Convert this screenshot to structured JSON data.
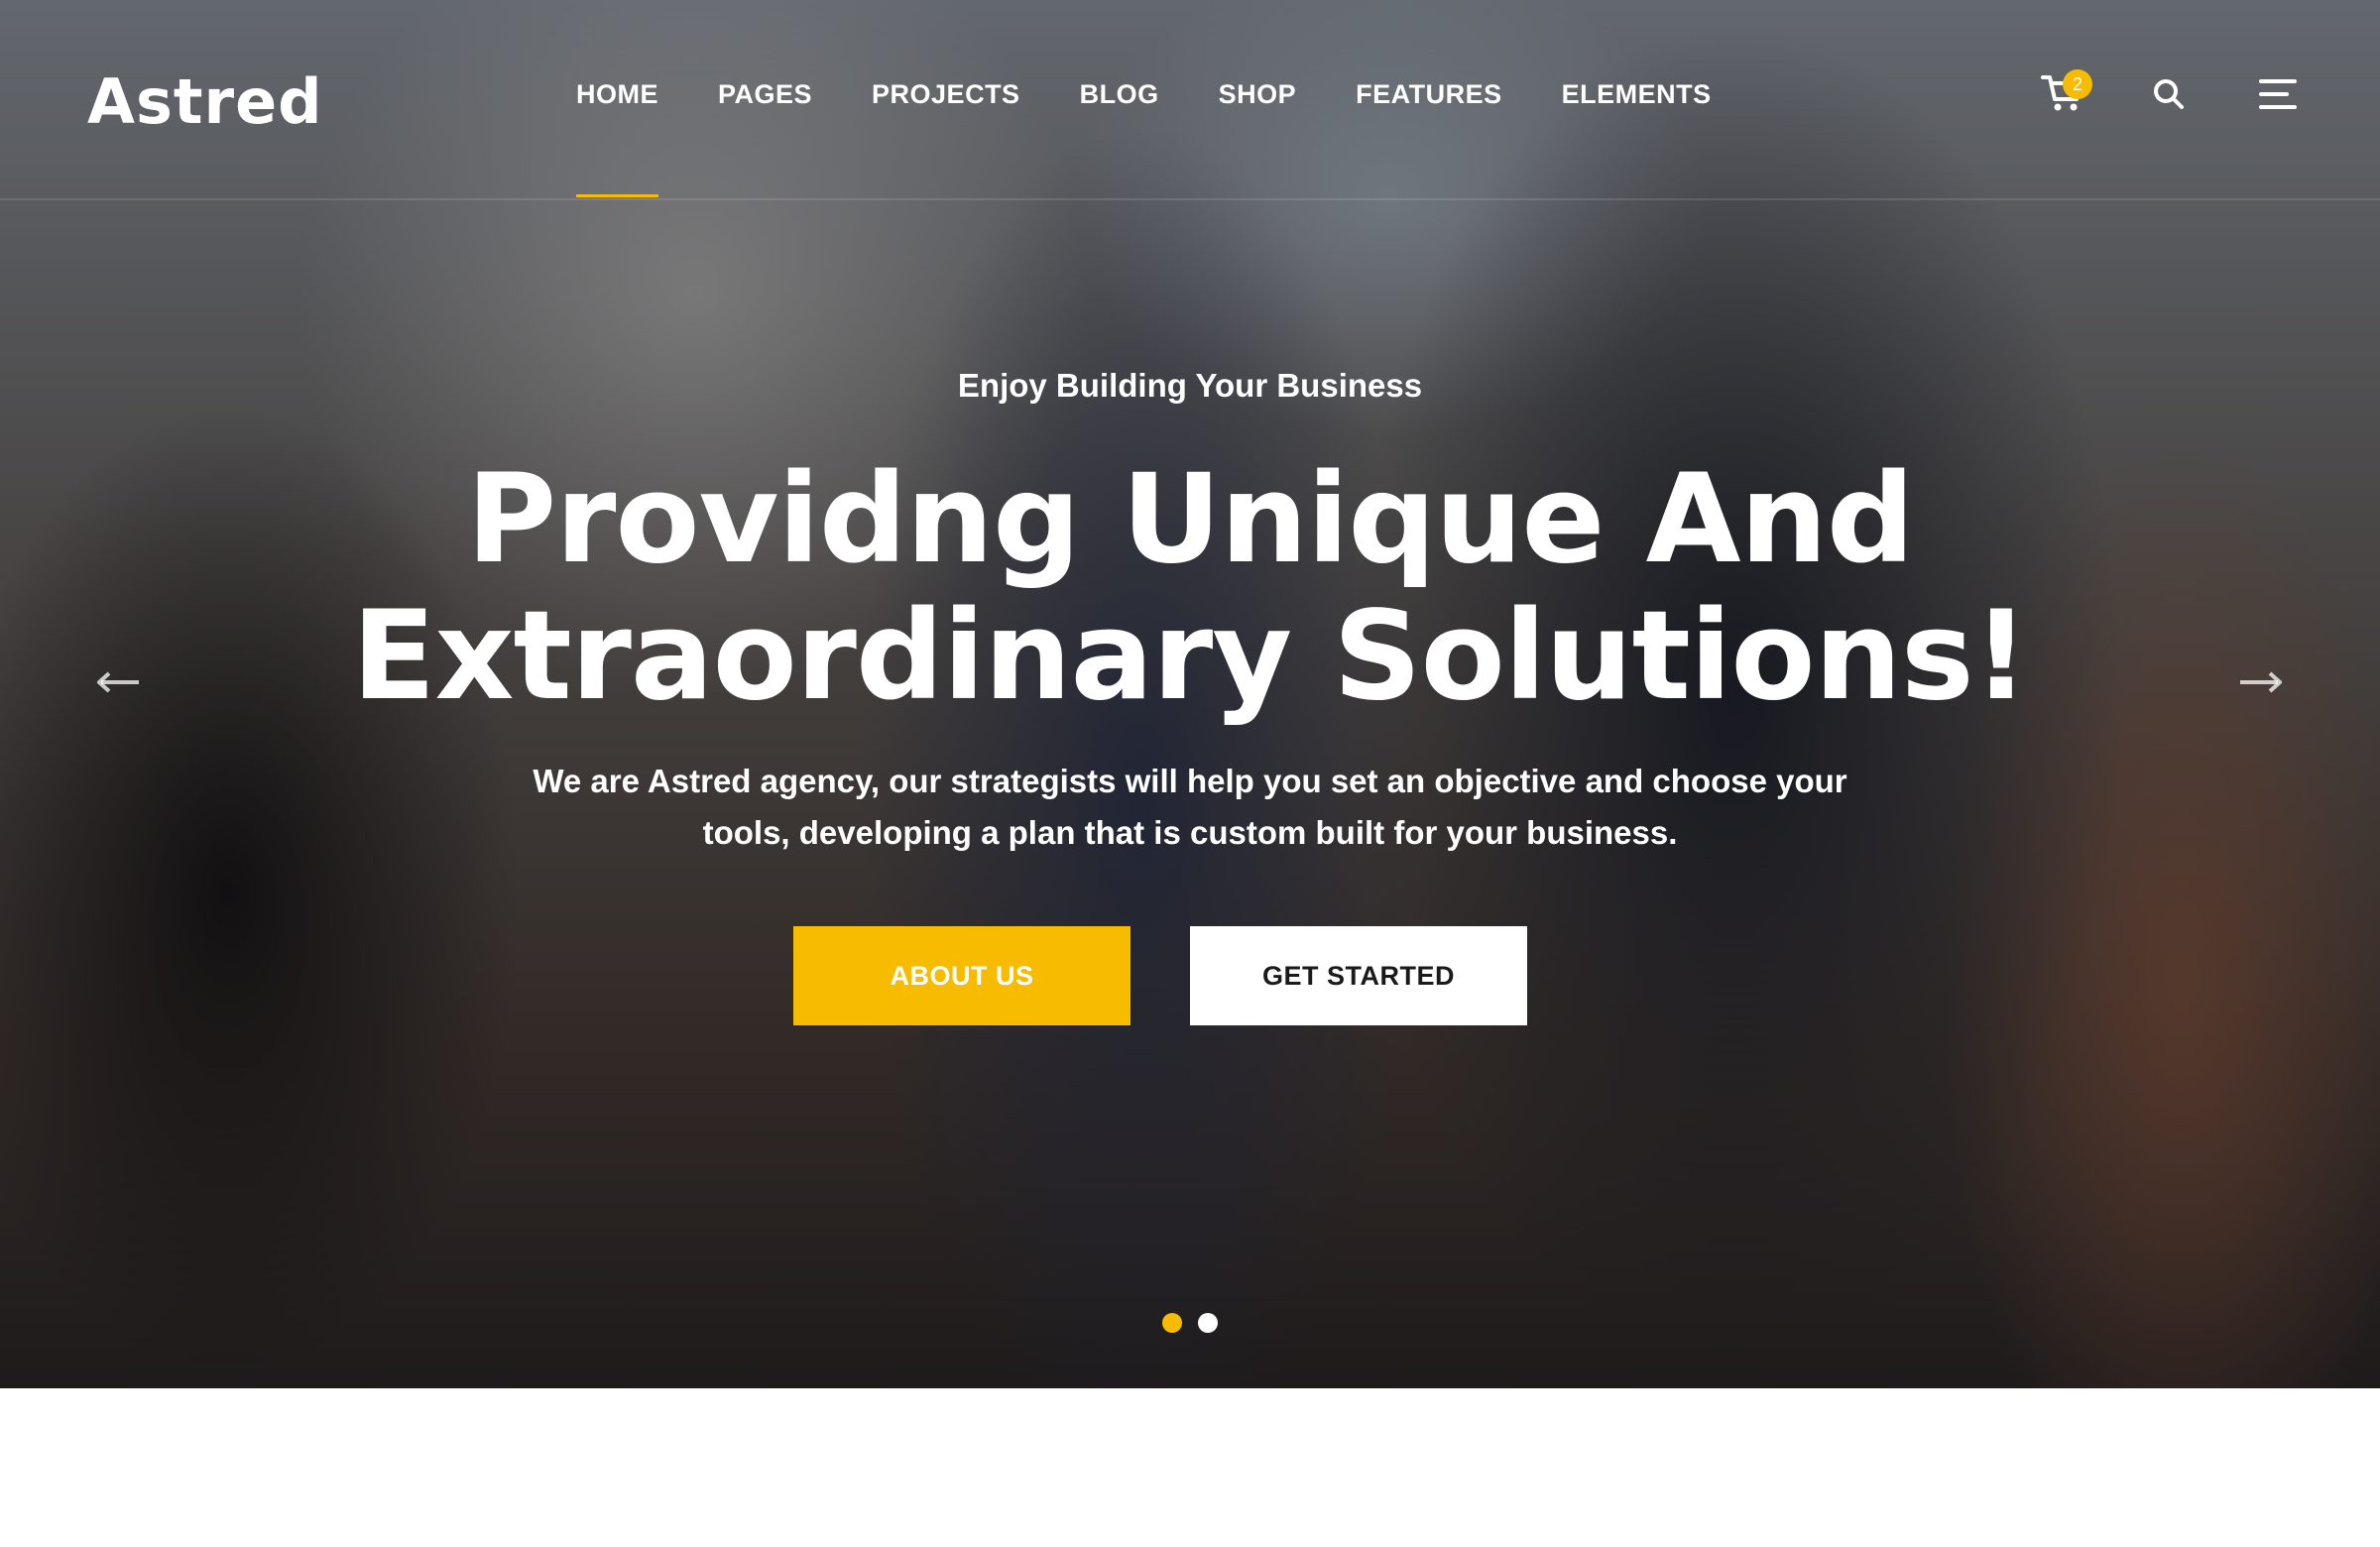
{
  "brand": {
    "logo": "Astred"
  },
  "nav": {
    "items": [
      {
        "label": "HOME",
        "active": true
      },
      {
        "label": "PAGES",
        "active": false
      },
      {
        "label": "PROJECTS",
        "active": false
      },
      {
        "label": "BLOG",
        "active": false
      },
      {
        "label": "SHOP",
        "active": false
      },
      {
        "label": "FEATURES",
        "active": false
      },
      {
        "label": "ELEMENTS",
        "active": false
      }
    ],
    "cart_count": "2",
    "icons": [
      "cart-icon",
      "search-icon",
      "hamburger-menu-icon"
    ]
  },
  "hero": {
    "eyebrow": "Enjoy Building Your Business",
    "headline_line1": "Providng Unique And",
    "headline_line2": "Extraordinary Solutions!",
    "description_line1": "We are Astred agency, our strategists will help you set an objective and choose your",
    "description_line2": "tools, developing a plan that is custom built for your business.",
    "primary_button": "ABOUT US",
    "secondary_button": "GET STARTED",
    "slide_count": 2,
    "active_slide": 1
  },
  "colors": {
    "accent": "#f7bb00",
    "text_light": "#ffffff",
    "text_dark": "#1a1a1a"
  }
}
